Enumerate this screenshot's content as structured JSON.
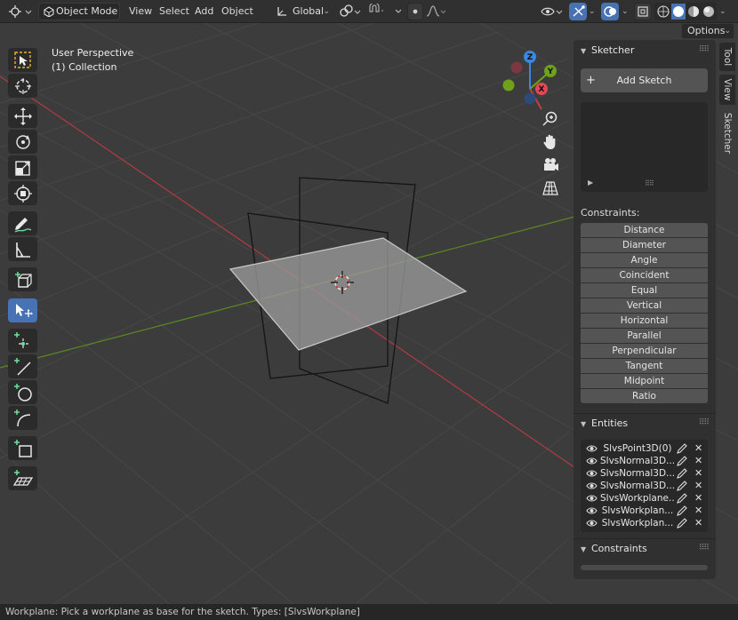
{
  "header": {
    "mode": "Object Mode",
    "menus": [
      "View",
      "Select",
      "Add",
      "Object"
    ],
    "orientation": "Global",
    "options_label": "Options"
  },
  "viewport": {
    "title": "User Perspective",
    "collection": "(1) Collection",
    "gizmo_axes": [
      "X",
      "Y",
      "Z"
    ]
  },
  "toolbar": {
    "tools": [
      "select-box",
      "cursor",
      "move",
      "rotate",
      "scale",
      "transform",
      "annotate",
      "measure",
      "add-cube",
      "sketch-select",
      "add-point",
      "add-line",
      "add-circle",
      "add-arc",
      "add-rectangle",
      "add-workplane"
    ],
    "active": "sketch-select"
  },
  "sidebar": {
    "tabs": [
      "Tool",
      "View",
      "Sketcher"
    ],
    "active_tab": "Sketcher",
    "sketcher_title": "Sketcher",
    "add_sketch": "Add Sketch",
    "constraints_label": "Constraints:",
    "constraint_buttons": [
      "Distance",
      "Diameter",
      "Angle",
      "Coincident",
      "Equal",
      "Vertical",
      "Horizontal",
      "Parallel",
      "Perpendicular",
      "Tangent",
      "Midpoint",
      "Ratio"
    ],
    "entities_title": "Entities",
    "entities": [
      "SlvsPoint3D(0)",
      "SlvsNormal3D...",
      "SlvsNormal3D...",
      "SlvsNormal3D...",
      "SlvsWorkplane...",
      "SlvsWorkplan...",
      "SlvsWorkplan..."
    ],
    "constraints_panel_title": "Constraints"
  },
  "status": "Workplane: Pick a workplane as base for the sketch. Types: [SlvsWorkplane]",
  "colors": {
    "accent": "#4772b3",
    "x_axis": "#e34756",
    "y_axis": "#6ea21b",
    "z_axis": "#3b86e0",
    "new_tool_plus": "#6fe0a0"
  }
}
